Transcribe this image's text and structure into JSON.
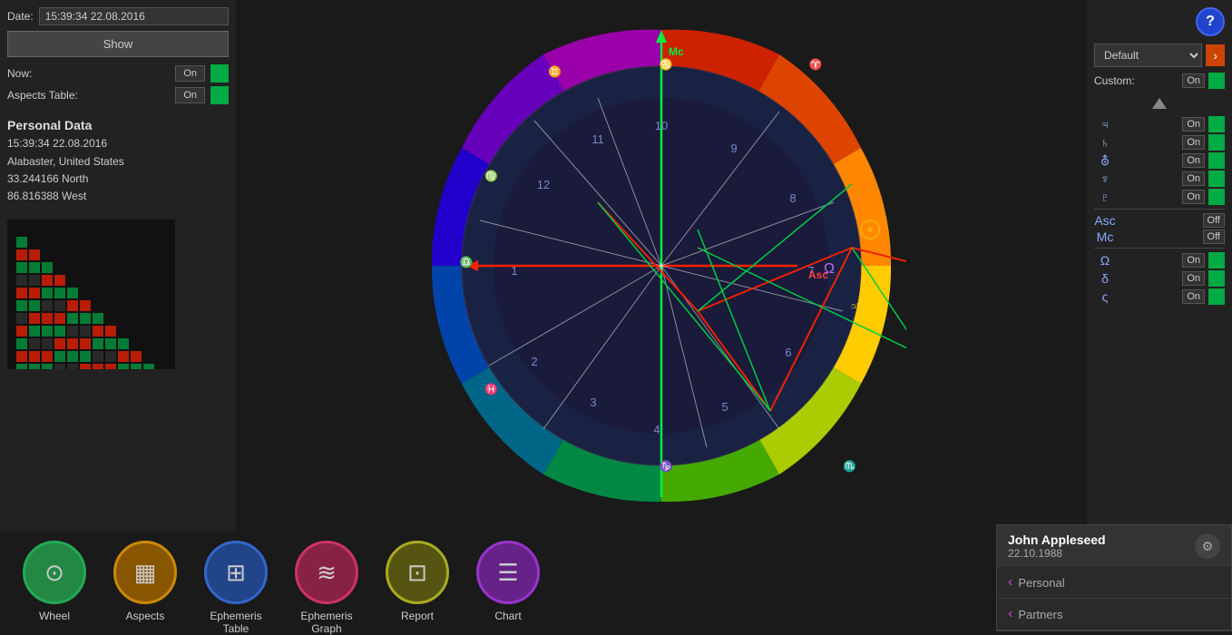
{
  "header": {
    "date_label": "Date:",
    "date_value": "15:39:34 22.08.2016",
    "show_btn": "Show"
  },
  "left_panel": {
    "now_label": "Now:",
    "now_value": "On",
    "aspects_table_label": "Aspects Table:",
    "aspects_table_value": "On",
    "personal_data": {
      "title": "Personal Data",
      "datetime": "15:39:34 22.08.2016",
      "location": "Alabaster, United States",
      "lat": "33.244166 North",
      "lon": "86.816388 West"
    }
  },
  "right_panel": {
    "help_label": "?",
    "default_label": "Default",
    "arrow_label": "›",
    "custom_label": "Custom:",
    "custom_value": "On",
    "triangle_up": true,
    "planets": [
      {
        "symbol": "♃",
        "name": "Jupiter",
        "value": "On",
        "active": true
      },
      {
        "symbol": "♄",
        "name": "Saturn",
        "value": "On",
        "active": true
      },
      {
        "symbol": "⛢",
        "name": "Uranus",
        "value": "On",
        "active": true
      },
      {
        "symbol": "♆",
        "name": "Neptune",
        "value": "On",
        "active": true
      },
      {
        "symbol": "♇",
        "name": "Pluto",
        "value": "On",
        "active": true
      },
      {
        "symbol": "Asc",
        "name": "Ascendant",
        "value": "Off",
        "active": false
      },
      {
        "symbol": "Mc",
        "name": "MidHeaven",
        "value": "Off",
        "active": false
      },
      {
        "symbol": "Ω",
        "name": "Node",
        "value": "On",
        "active": true
      },
      {
        "symbol": "δ",
        "name": "Lilith",
        "value": "On",
        "active": true
      },
      {
        "symbol": "ς",
        "name": "Chiron",
        "value": "On",
        "active": true
      }
    ]
  },
  "bottom_nav": [
    {
      "id": "wheel",
      "label": "Wheel",
      "icon": "⊙",
      "color": "#228844",
      "border_color": "#22aa55"
    },
    {
      "id": "aspects",
      "label": "Aspects",
      "icon": "▦",
      "color": "#885500",
      "border_color": "#cc8800"
    },
    {
      "id": "ephemeris_table",
      "label": "Ephemeris\nTable",
      "icon": "⊞",
      "color": "#224488",
      "border_color": "#3366cc"
    },
    {
      "id": "ephemeris_graph",
      "label": "Ephemeris\nGraph",
      "icon": "≋",
      "color": "#882244",
      "border_color": "#cc3366"
    },
    {
      "id": "report",
      "label": "Report",
      "icon": "⊡",
      "color": "#555511",
      "border_color": "#aaaa22"
    },
    {
      "id": "chart",
      "label": "Chart",
      "icon": "☰",
      "color": "#662288",
      "border_color": "#9933cc"
    }
  ],
  "profile_card": {
    "name": "John Appleseed",
    "date": "22.10.1988",
    "gear_icon": "⚙",
    "rows": [
      {
        "label": "Personal"
      },
      {
        "label": "Partners"
      }
    ]
  },
  "wheel": {
    "mc_label": "Mc",
    "asc_label": "Asc",
    "house_numbers": [
      "1",
      "2",
      "3",
      "4",
      "5",
      "6",
      "7",
      "8",
      "9",
      "10",
      "11",
      "12"
    ]
  }
}
